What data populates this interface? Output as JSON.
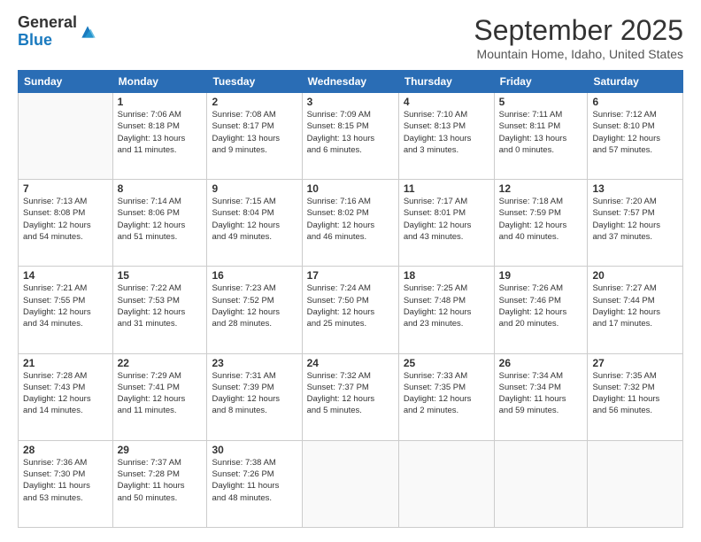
{
  "logo": {
    "general": "General",
    "blue": "Blue"
  },
  "header": {
    "month_year": "September 2025",
    "location": "Mountain Home, Idaho, United States"
  },
  "weekdays": [
    "Sunday",
    "Monday",
    "Tuesday",
    "Wednesday",
    "Thursday",
    "Friday",
    "Saturday"
  ],
  "weeks": [
    [
      {
        "day": "",
        "info": ""
      },
      {
        "day": "1",
        "info": "Sunrise: 7:06 AM\nSunset: 8:18 PM\nDaylight: 13 hours\nand 11 minutes."
      },
      {
        "day": "2",
        "info": "Sunrise: 7:08 AM\nSunset: 8:17 PM\nDaylight: 13 hours\nand 9 minutes."
      },
      {
        "day": "3",
        "info": "Sunrise: 7:09 AM\nSunset: 8:15 PM\nDaylight: 13 hours\nand 6 minutes."
      },
      {
        "day": "4",
        "info": "Sunrise: 7:10 AM\nSunset: 8:13 PM\nDaylight: 13 hours\nand 3 minutes."
      },
      {
        "day": "5",
        "info": "Sunrise: 7:11 AM\nSunset: 8:11 PM\nDaylight: 13 hours\nand 0 minutes."
      },
      {
        "day": "6",
        "info": "Sunrise: 7:12 AM\nSunset: 8:10 PM\nDaylight: 12 hours\nand 57 minutes."
      }
    ],
    [
      {
        "day": "7",
        "info": "Sunrise: 7:13 AM\nSunset: 8:08 PM\nDaylight: 12 hours\nand 54 minutes."
      },
      {
        "day": "8",
        "info": "Sunrise: 7:14 AM\nSunset: 8:06 PM\nDaylight: 12 hours\nand 51 minutes."
      },
      {
        "day": "9",
        "info": "Sunrise: 7:15 AM\nSunset: 8:04 PM\nDaylight: 12 hours\nand 49 minutes."
      },
      {
        "day": "10",
        "info": "Sunrise: 7:16 AM\nSunset: 8:02 PM\nDaylight: 12 hours\nand 46 minutes."
      },
      {
        "day": "11",
        "info": "Sunrise: 7:17 AM\nSunset: 8:01 PM\nDaylight: 12 hours\nand 43 minutes."
      },
      {
        "day": "12",
        "info": "Sunrise: 7:18 AM\nSunset: 7:59 PM\nDaylight: 12 hours\nand 40 minutes."
      },
      {
        "day": "13",
        "info": "Sunrise: 7:20 AM\nSunset: 7:57 PM\nDaylight: 12 hours\nand 37 minutes."
      }
    ],
    [
      {
        "day": "14",
        "info": "Sunrise: 7:21 AM\nSunset: 7:55 PM\nDaylight: 12 hours\nand 34 minutes."
      },
      {
        "day": "15",
        "info": "Sunrise: 7:22 AM\nSunset: 7:53 PM\nDaylight: 12 hours\nand 31 minutes."
      },
      {
        "day": "16",
        "info": "Sunrise: 7:23 AM\nSunset: 7:52 PM\nDaylight: 12 hours\nand 28 minutes."
      },
      {
        "day": "17",
        "info": "Sunrise: 7:24 AM\nSunset: 7:50 PM\nDaylight: 12 hours\nand 25 minutes."
      },
      {
        "day": "18",
        "info": "Sunrise: 7:25 AM\nSunset: 7:48 PM\nDaylight: 12 hours\nand 23 minutes."
      },
      {
        "day": "19",
        "info": "Sunrise: 7:26 AM\nSunset: 7:46 PM\nDaylight: 12 hours\nand 20 minutes."
      },
      {
        "day": "20",
        "info": "Sunrise: 7:27 AM\nSunset: 7:44 PM\nDaylight: 12 hours\nand 17 minutes."
      }
    ],
    [
      {
        "day": "21",
        "info": "Sunrise: 7:28 AM\nSunset: 7:43 PM\nDaylight: 12 hours\nand 14 minutes."
      },
      {
        "day": "22",
        "info": "Sunrise: 7:29 AM\nSunset: 7:41 PM\nDaylight: 12 hours\nand 11 minutes."
      },
      {
        "day": "23",
        "info": "Sunrise: 7:31 AM\nSunset: 7:39 PM\nDaylight: 12 hours\nand 8 minutes."
      },
      {
        "day": "24",
        "info": "Sunrise: 7:32 AM\nSunset: 7:37 PM\nDaylight: 12 hours\nand 5 minutes."
      },
      {
        "day": "25",
        "info": "Sunrise: 7:33 AM\nSunset: 7:35 PM\nDaylight: 12 hours\nand 2 minutes."
      },
      {
        "day": "26",
        "info": "Sunrise: 7:34 AM\nSunset: 7:34 PM\nDaylight: 11 hours\nand 59 minutes."
      },
      {
        "day": "27",
        "info": "Sunrise: 7:35 AM\nSunset: 7:32 PM\nDaylight: 11 hours\nand 56 minutes."
      }
    ],
    [
      {
        "day": "28",
        "info": "Sunrise: 7:36 AM\nSunset: 7:30 PM\nDaylight: 11 hours\nand 53 minutes."
      },
      {
        "day": "29",
        "info": "Sunrise: 7:37 AM\nSunset: 7:28 PM\nDaylight: 11 hours\nand 50 minutes."
      },
      {
        "day": "30",
        "info": "Sunrise: 7:38 AM\nSunset: 7:26 PM\nDaylight: 11 hours\nand 48 minutes."
      },
      {
        "day": "",
        "info": ""
      },
      {
        "day": "",
        "info": ""
      },
      {
        "day": "",
        "info": ""
      },
      {
        "day": "",
        "info": ""
      }
    ]
  ]
}
